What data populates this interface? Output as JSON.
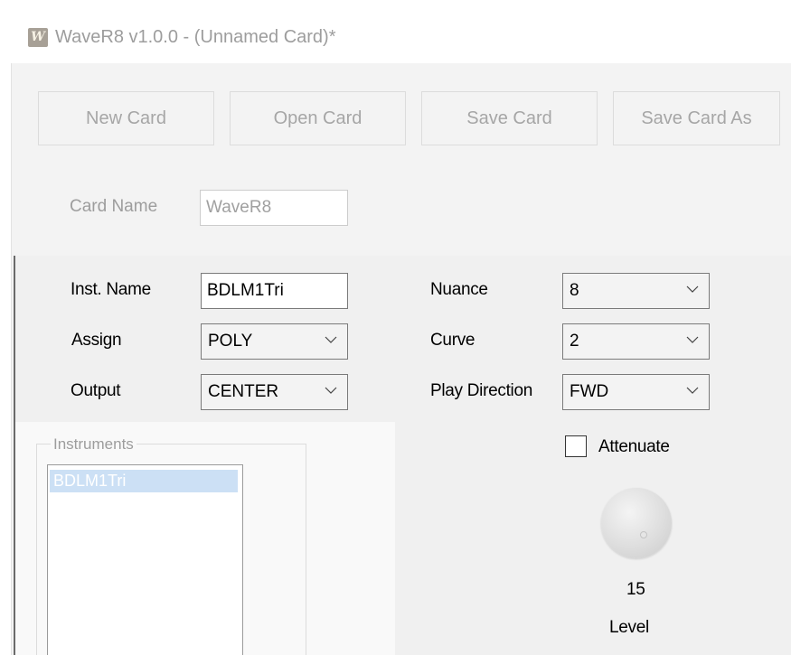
{
  "window": {
    "title": "WaveR8 v1.0.0 - (Unnamed Card)*",
    "app_icon_glyph": "W"
  },
  "toolbar": {
    "new_card": "New Card",
    "open_card": "Open Card",
    "save_card": "Save Card",
    "save_card_as": "Save Card As"
  },
  "card": {
    "name_label": "Card Name",
    "name_value": "WaveR8"
  },
  "instrument": {
    "inst_name_label": "Inst. Name",
    "inst_name_value": "BDLM1Tri",
    "assign_label": "Assign",
    "assign_value": "POLY",
    "output_label": "Output",
    "output_value": "CENTER",
    "nuance_label": "Nuance",
    "nuance_value": "8",
    "curve_label": "Curve",
    "curve_value": "2",
    "play_direction_label": "Play Direction",
    "play_direction_value": "FWD",
    "attenuate_label": "Attenuate",
    "attenuate_checked": false,
    "level_value": "15",
    "level_label": "Level"
  },
  "instruments_list": {
    "group_title": "Instruments",
    "items": [
      "BDLM1Tri"
    ],
    "selected_index": 0
  },
  "colors": {
    "selection": "#cce0f5",
    "panel_bg": "#f0f0f0",
    "disabled_text": "#9d9d9d"
  },
  "icons": {
    "dropdown": "chevron-down-icon",
    "app": "wave-logo-icon"
  }
}
